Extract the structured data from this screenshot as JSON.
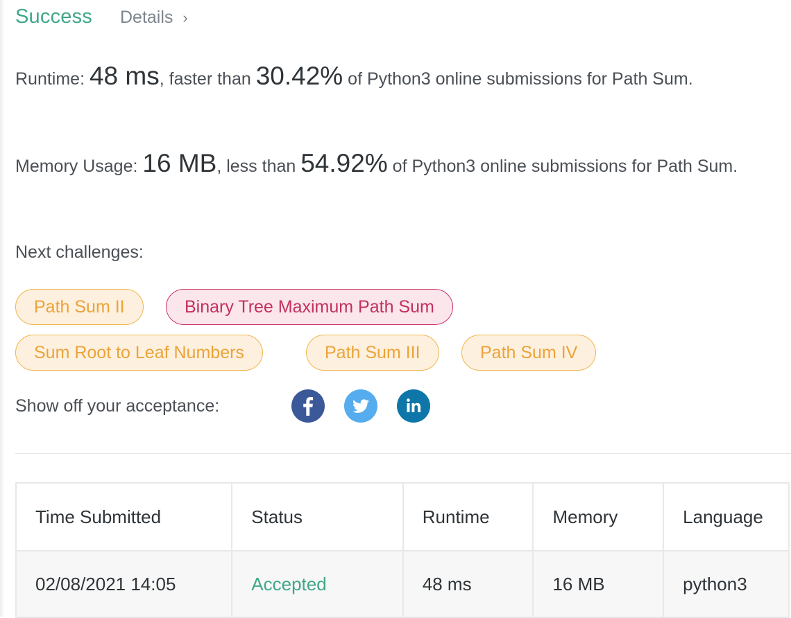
{
  "header": {
    "status": "Success",
    "details_label": "Details",
    "chevron": "›"
  },
  "runtime": {
    "label": "Runtime: ",
    "value": "48 ms",
    "comparison": ", faster than ",
    "percent": "30.42%",
    "suffix": " of Python3 online submissions for Path Sum."
  },
  "memory": {
    "label": "Memory Usage: ",
    "value": "16 MB",
    "comparison": ", less than ",
    "percent": "54.92%",
    "suffix": " of Python3 online submissions for Path Sum."
  },
  "next": {
    "label": "Next challenges:",
    "challenges": [
      {
        "title": "Path Sum II",
        "difficulty": "medium"
      },
      {
        "title": "Binary Tree Maximum Path Sum",
        "difficulty": "hard"
      },
      {
        "title": "Sum Root to Leaf Numbers",
        "difficulty": "medium"
      },
      {
        "title": "Path Sum III",
        "difficulty": "medium"
      },
      {
        "title": "Path Sum IV",
        "difficulty": "medium"
      }
    ]
  },
  "share": {
    "label": "Show off your acceptance:",
    "networks": [
      {
        "name": "facebook",
        "icon": "facebook-icon",
        "color": "#3b5998"
      },
      {
        "name": "twitter",
        "icon": "twitter-icon",
        "color": "#55acee"
      },
      {
        "name": "linkedin",
        "icon": "linkedin-icon",
        "color": "#0e76a8"
      }
    ]
  },
  "table": {
    "headers": [
      "Time Submitted",
      "Status",
      "Runtime",
      "Memory",
      "Language"
    ],
    "rows": [
      [
        "02/08/2021 14:05",
        "Accepted",
        "48 ms",
        "16 MB",
        "python3"
      ]
    ]
  },
  "colors": {
    "success": "#3fa788",
    "medium": "#eba33a",
    "hard": "#c2305f"
  }
}
